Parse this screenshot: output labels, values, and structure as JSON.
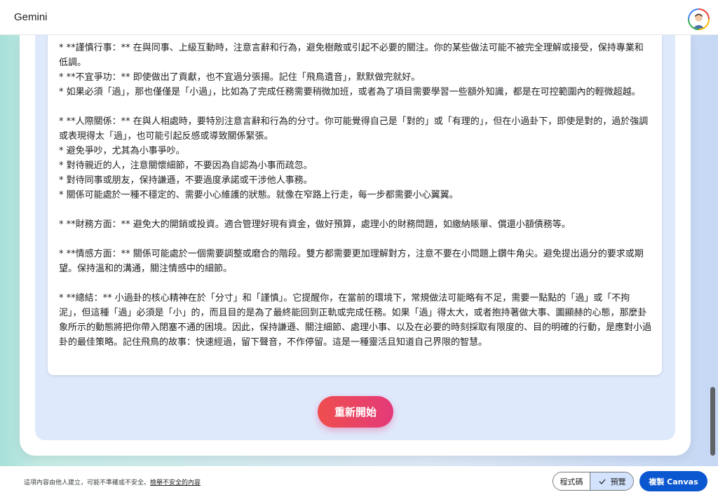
{
  "app": {
    "title": "Gemini"
  },
  "content": {
    "paragraphs": [
      "* **謹慎行事：** 在與同事、上級互動時，注意言辭和行為，避免樹敵或引起不必要的關注。你的某些做法可能不被完全理解或接受，保持專業和低調。",
      "* **不宜爭功：** 即使做出了貢獻，也不宜過分張揚。記住「飛鳥遺音」，默默做完就好。",
      "* 如果必須「過」，那也僅僅是「小過」，比如為了完成任務需要稍微加班，或者為了項目需要學習一些額外知識，都是在可控範圍內的輕微超越。",
      "",
      "* **人際關係：** 在與人相處時，要特別注意言辭和行為的分寸。你可能覺得自己是「對的」或「有理的」，但在小過卦下，即使是對的，過於強調或表現得太「過」，也可能引起反感或導致關係緊張。",
      "* 避免爭吵，尤其為小事爭吵。",
      "* 對待親近的人，注意關懷細節，不要因為自認為小事而疏忽。",
      "* 對待同事或朋友，保持謙遜，不要過度承諾或干涉他人事務。",
      "* 關係可能處於一種不穩定的、需要小心維護的狀態。就像在窄路上行走，每一步都需要小心翼翼。",
      "",
      "* **財務方面：** 避免大的開銷或投資。適合管理好現有資金，做好預算，處理小的財務問題，如繳納賬單、償還小額債務等。",
      "",
      "* **情感方面：** 關係可能處於一個需要調整或磨合的階段。雙方都需要更加理解對方，注意不要在小問題上鑽牛角尖。避免提出過分的要求或期望。保持溫和的溝通，關注情感中的細節。",
      "",
      "* **總結：** 小過卦的核心精神在於「分寸」和「謹慎」。它提醒你，在當前的環境下，常規做法可能略有不足，需要一點點的「過」或「不拘泥」，但這種「過」必須是「小」的，而且目的是為了最終能回到正軌或完成任務。如果「過」得太大，或者抱持著做大事、圖顯赫的心態，那麼卦象所示的動態將把你帶入閉塞不通的困境。因此，保持謙遜、關注細節、處理小事、以及在必要的時刻採取有限度的、目的明確的行動，是應對小過卦的最佳策略。記住飛鳥的故事：快速經過，留下聲音，不作停留。這是一種靈活且知道自己界限的智慧。"
    ],
    "restart_label": "重新開始"
  },
  "footer": {
    "disclaimer": "這項內容由他人建立，可能不準確或不安全。",
    "report_link": "檢舉不安全的內容",
    "code_label": "程式碼",
    "preview_label": "預覽",
    "copy_label": "複製 Canvas"
  },
  "icons": {
    "avatar": "avatar-icon",
    "check": "check-icon"
  },
  "colors": {
    "accent": "#0b57d0",
    "restart_start": "#ef4e4e",
    "restart_end": "#e43a7a"
  }
}
